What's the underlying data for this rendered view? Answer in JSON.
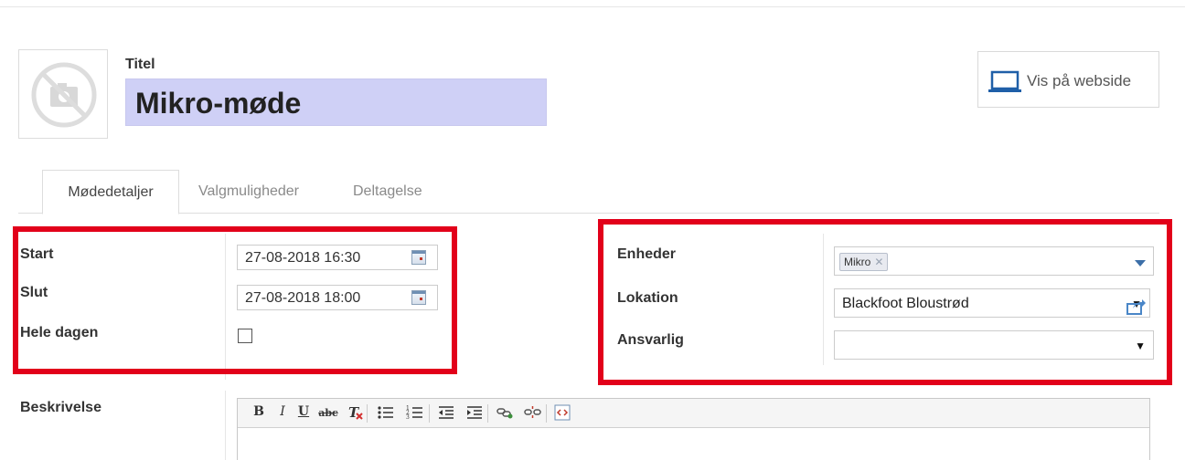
{
  "header": {
    "title_label": "Titel",
    "title_value": "Mikro-møde",
    "website_button": "Vis på webside"
  },
  "tabs": [
    {
      "label": "Mødedetaljer",
      "active": true
    },
    {
      "label": "Valgmuligheder",
      "active": false
    },
    {
      "label": "Deltagelse",
      "active": false
    }
  ],
  "left_fields": {
    "start_label": "Start",
    "start_value": "27-08-2018 16:30",
    "slut_label": "Slut",
    "slut_value": "27-08-2018 18:00",
    "hele_dagen_label": "Hele dagen",
    "hele_dagen_checked": false
  },
  "right_fields": {
    "enheder_label": "Enheder",
    "enheder_tags": [
      "Mikro"
    ],
    "lokation_label": "Lokation",
    "lokation_value": "Blackfoot Bloustrød",
    "ansvarlig_label": "Ansvarlig",
    "ansvarlig_value": ""
  },
  "description": {
    "label": "Beskrivelse",
    "toolbar": [
      "bold",
      "italic",
      "underline",
      "strikethrough",
      "remove-format",
      "bullet-list",
      "numbered-list",
      "outdent",
      "indent",
      "link",
      "unlink",
      "code-view"
    ]
  },
  "colors": {
    "highlight_border": "#e2001a",
    "title_bg": "#cfd0f6",
    "dropdown_arrow": "#3c6fa8"
  }
}
